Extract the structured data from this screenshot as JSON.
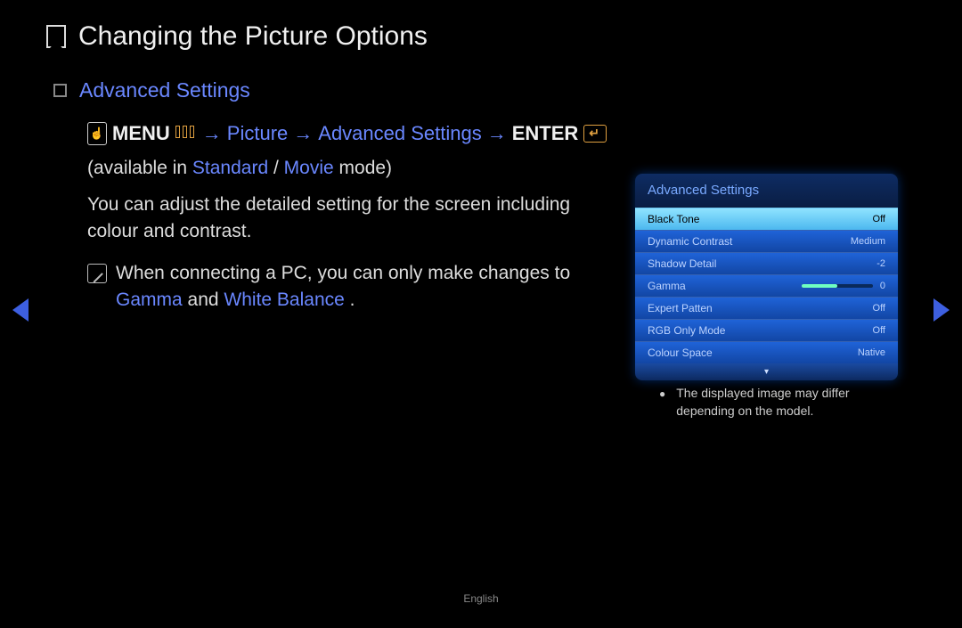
{
  "title": "Changing the Picture Options",
  "section_heading": "Advanced Settings",
  "nav": {
    "menu": "MENU",
    "picture": "Picture",
    "adv": "Advanced Settings",
    "enter": "ENTER",
    "arrow": "→"
  },
  "avail_prefix": "(available in ",
  "avail_standard": "Standard",
  "avail_sep": " / ",
  "avail_movie": "Movie",
  "avail_suffix": " mode)",
  "desc": "You can adjust the detailed setting for the screen including colour and contrast.",
  "note_prefix": "When connecting a PC, you can only make changes to ",
  "note_gamma": "Gamma",
  "note_and": " and ",
  "note_wb": "White Balance",
  "note_suffix": " .",
  "panel": {
    "title": "Advanced Settings",
    "rows": [
      {
        "label": "Black Tone",
        "value": "Off",
        "selected": true
      },
      {
        "label": "Dynamic Contrast",
        "value": "Medium"
      },
      {
        "label": "Shadow Detail",
        "value": "-2"
      },
      {
        "label": "Gamma",
        "value": "0",
        "slider_pct": 50
      },
      {
        "label": "Expert Patten",
        "value": "Off"
      },
      {
        "label": "RGB Only Mode",
        "value": "Off"
      },
      {
        "label": "Colour Space",
        "value": "Native"
      }
    ],
    "more": "▾"
  },
  "panel_caption": "The displayed image may differ depending on the model.",
  "footer_lang": "English"
}
